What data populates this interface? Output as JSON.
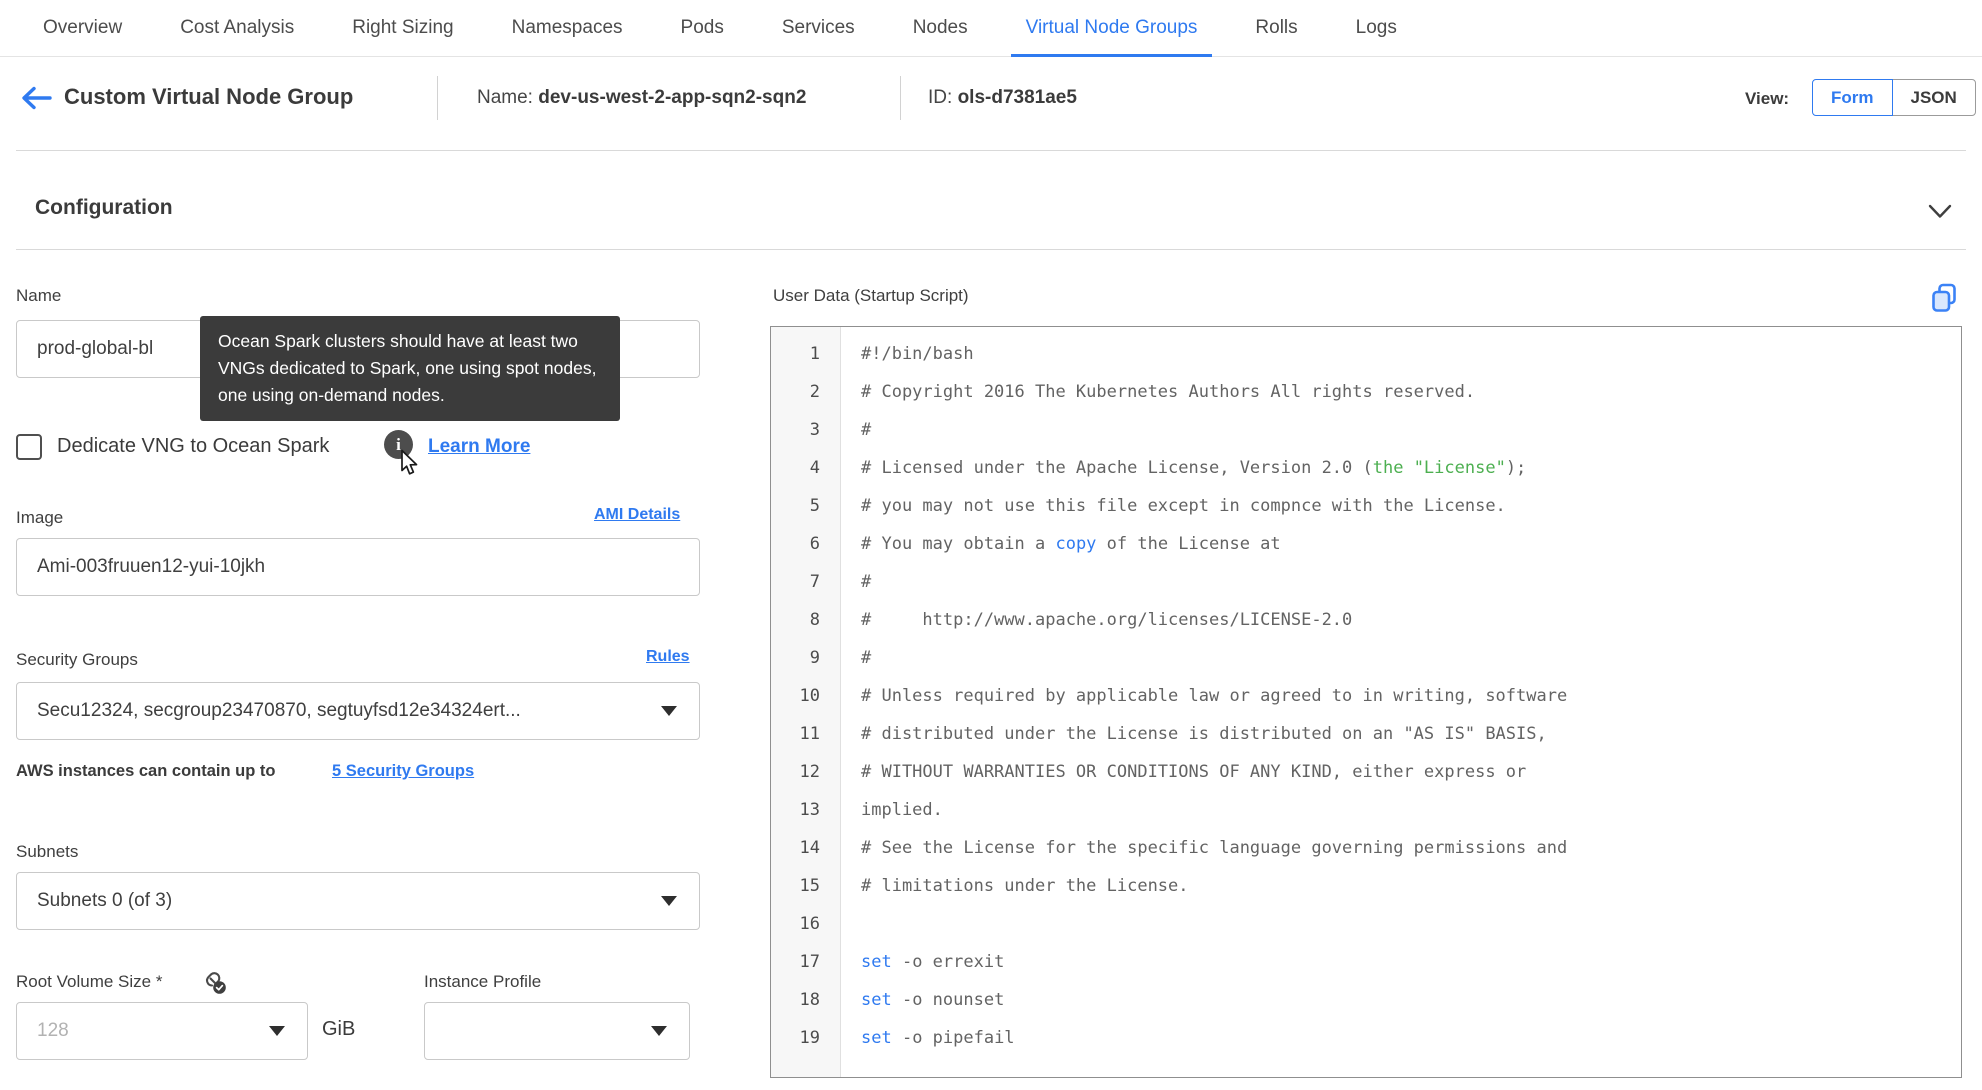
{
  "nav": {
    "tabs": [
      {
        "label": "Overview",
        "active": false
      },
      {
        "label": "Cost Analysis",
        "active": false
      },
      {
        "label": "Right Sizing",
        "active": false
      },
      {
        "label": "Namespaces",
        "active": false
      },
      {
        "label": "Pods",
        "active": false
      },
      {
        "label": "Services",
        "active": false
      },
      {
        "label": "Nodes",
        "active": false
      },
      {
        "label": "Virtual Node Groups",
        "active": true
      },
      {
        "label": "Rolls",
        "active": false
      },
      {
        "label": "Logs",
        "active": false
      }
    ]
  },
  "header": {
    "title": "Custom Virtual Node Group",
    "name_label": "Name:",
    "name_value": "dev-us-west-2-app-sqn2-sqn2",
    "id_label": "ID:",
    "id_value": "ols-d7381ae5",
    "view_label": "View:",
    "view_options": [
      {
        "label": "Form",
        "selected": true
      },
      {
        "label": "JSON",
        "selected": false
      }
    ]
  },
  "section": {
    "title": "Configuration"
  },
  "form": {
    "name": {
      "label": "Name",
      "value": "prod-global-bl"
    },
    "tooltip": {
      "text": "Ocean Spark clusters should have at least two VNGs dedicated to Spark, one using spot nodes, one using on-demand nodes."
    },
    "dedicate": {
      "label": "Dedicate VNG to Ocean Spark",
      "checked": false,
      "learn_more_label": "Learn More"
    },
    "image": {
      "label": "Image",
      "link_label": "AMI Details",
      "value": "Ami-003fruuen12-yui-10jkh"
    },
    "security_groups": {
      "label": "Security Groups",
      "link_label": "Rules",
      "value": "Secu12324, secgroup23470870, segtuyfsd12e34324ert...",
      "helper_text": "AWS instances can contain up to",
      "helper_link_label": "5 Security Groups"
    },
    "subnets": {
      "label": "Subnets",
      "value": "Subnets 0 (of 3)"
    },
    "root_volume": {
      "label": "Root Volume Size *",
      "placeholder": "128",
      "unit": "GiB"
    },
    "instance_profile": {
      "label": "Instance Profile",
      "value": ""
    }
  },
  "user_data": {
    "label": "User Data (Startup Script)",
    "lines": [
      {
        "n": "1",
        "segs": [
          [
            "#!/bin/bash",
            "d"
          ]
        ]
      },
      {
        "n": "2",
        "segs": [
          [
            "# Copyright 2016 The Kubernetes Authors All rights reserved.",
            "d"
          ]
        ]
      },
      {
        "n": "3",
        "segs": [
          [
            "#",
            "d"
          ]
        ]
      },
      {
        "n": "4",
        "segs": [
          [
            "# Licensed under the Apache License, Version 2.0 (",
            "d"
          ],
          [
            "the \"License\"",
            "g"
          ],
          [
            ");",
            "d"
          ]
        ]
      },
      {
        "n": "5",
        "segs": [
          [
            "# you may not use this file except in compnce with the License.",
            "d"
          ]
        ]
      },
      {
        "n": "6",
        "segs": [
          [
            "# You may obtain a ",
            "d"
          ],
          [
            "copy",
            "b"
          ],
          [
            " of the License at",
            "d"
          ]
        ]
      },
      {
        "n": "7",
        "segs": [
          [
            "#",
            "d"
          ]
        ]
      },
      {
        "n": "8",
        "segs": [
          [
            "#     http://www.apache.org/licenses/LICENSE-2.0",
            "d"
          ]
        ]
      },
      {
        "n": "9",
        "segs": [
          [
            "#",
            "d"
          ]
        ]
      },
      {
        "n": "10",
        "segs": [
          [
            "# Unless required by applicable law or agreed to in writing, software",
            "d"
          ]
        ]
      },
      {
        "n": "11",
        "segs": [
          [
            "# distributed under the License is distributed on an \"AS IS\" BASIS,",
            "d"
          ]
        ]
      },
      {
        "n": "12",
        "segs": [
          [
            "# WITHOUT WARRANTIES OR CONDITIONS OF ANY KIND, either express or",
            "d"
          ]
        ]
      },
      {
        "n": "13",
        "segs": [
          [
            "implied.",
            "d"
          ]
        ]
      },
      {
        "n": "14",
        "segs": [
          [
            "# See the License for the specific language governing permissions and",
            "d"
          ]
        ]
      },
      {
        "n": "15",
        "segs": [
          [
            "# limitations under the License.",
            "d"
          ]
        ]
      },
      {
        "n": "16",
        "segs": []
      },
      {
        "n": "17",
        "segs": [
          [
            "set",
            "b"
          ],
          [
            " -o errexit",
            "d"
          ]
        ]
      },
      {
        "n": "18",
        "segs": [
          [
            "set",
            "b"
          ],
          [
            " -o nounset",
            "d"
          ]
        ]
      },
      {
        "n": "19",
        "segs": [
          [
            "set",
            "b"
          ],
          [
            " -o pipefail",
            "d"
          ]
        ]
      }
    ]
  },
  "colors": {
    "accent_blue": "#2f7af0",
    "code_green": "#4caf50",
    "code_gray": "#636363",
    "tooltip_bg": "#3b3b3b"
  }
}
